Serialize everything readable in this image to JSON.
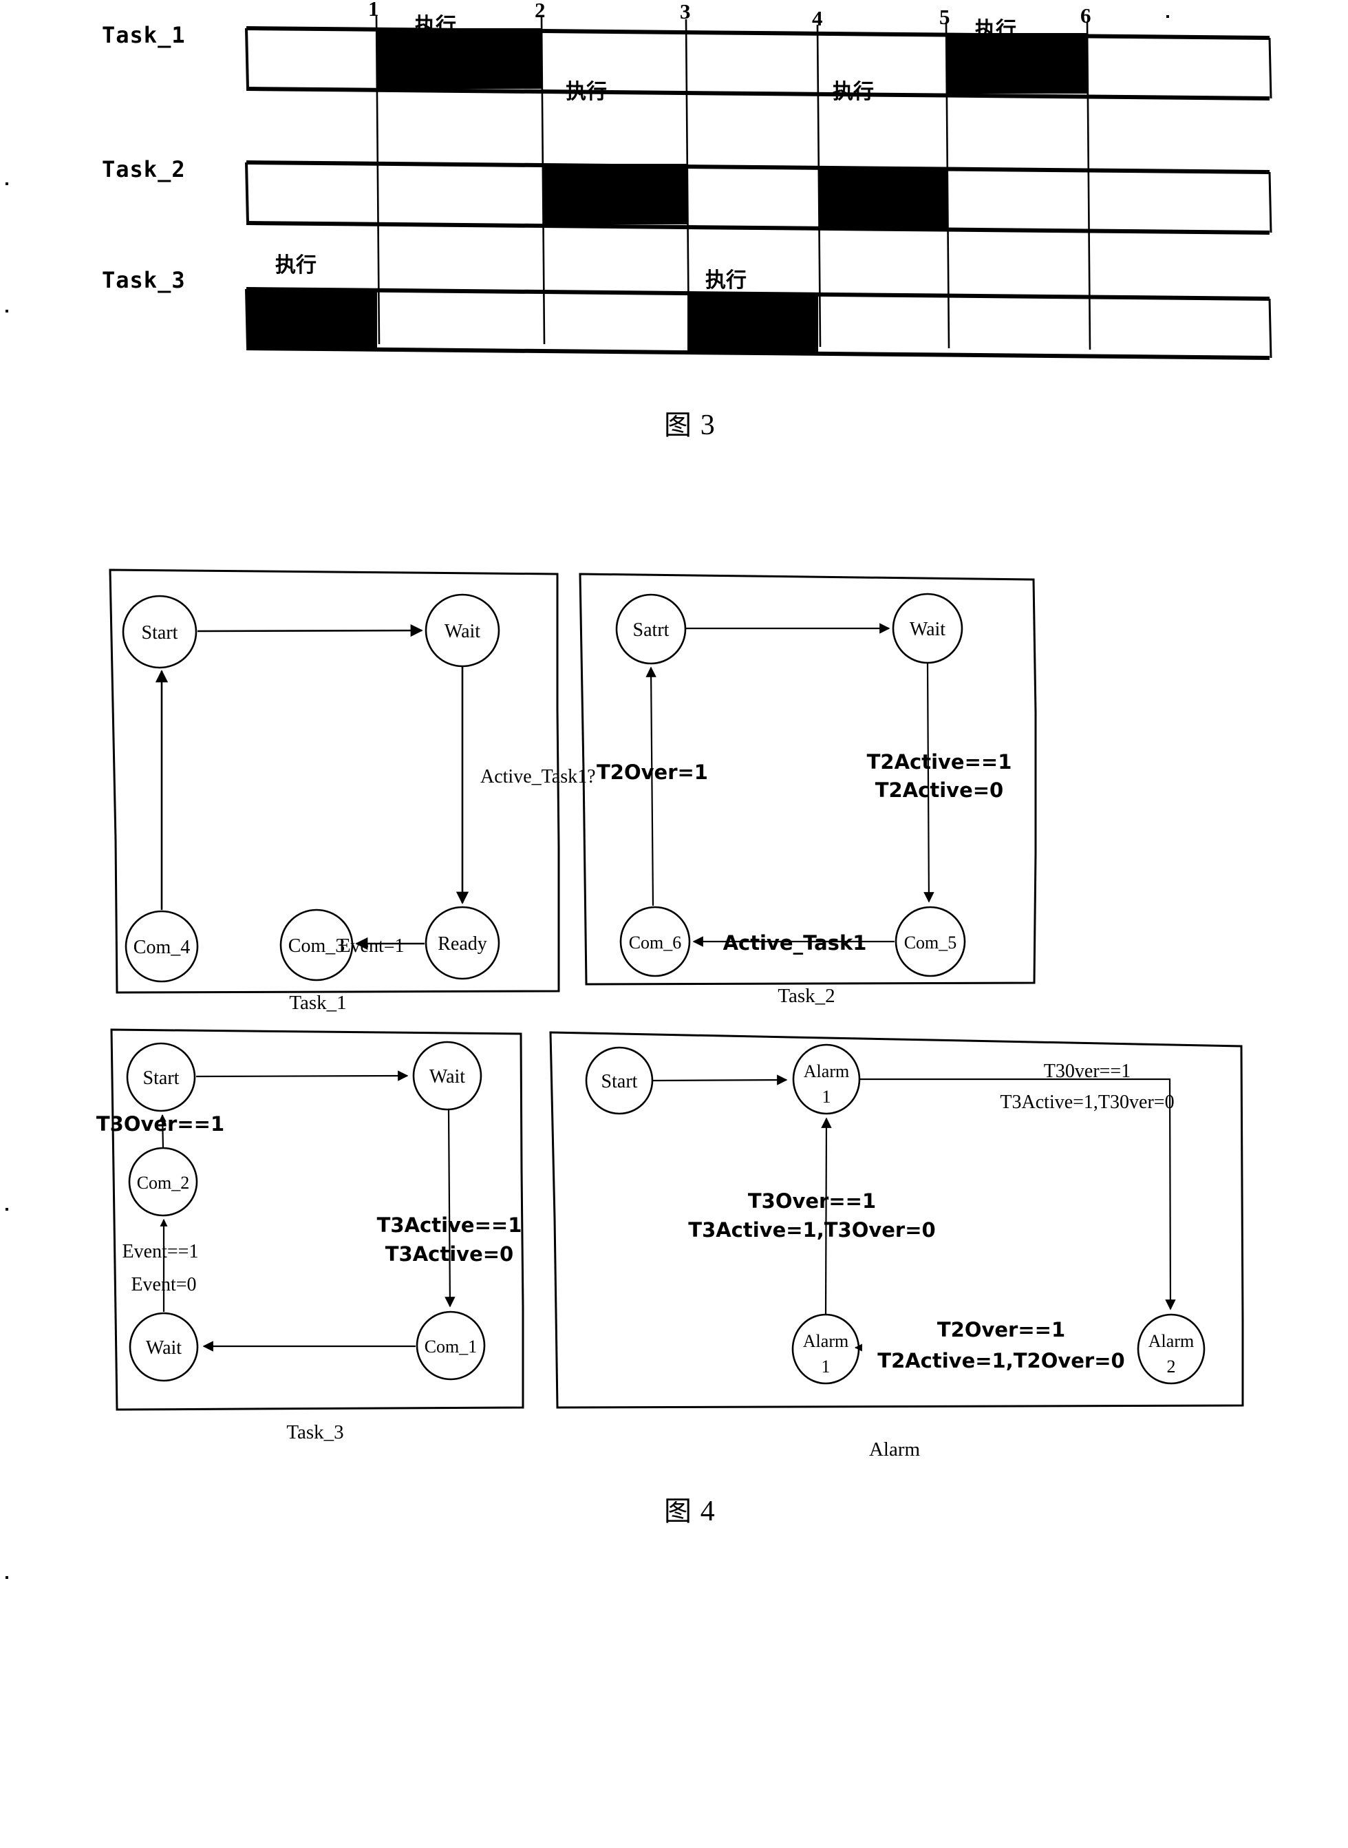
{
  "figure3": {
    "caption_cn": "图",
    "caption_num": "3",
    "tick_labels": [
      "1",
      "2",
      "3",
      "4",
      "5",
      "6"
    ],
    "exec_label": "执行",
    "rows": [
      {
        "label": "Task_1",
        "cells": [
          false,
          true,
          false,
          false,
          false,
          true,
          false
        ],
        "exec_markers": [
          1,
          5
        ]
      },
      {
        "label": "Task_2",
        "cells": [
          false,
          false,
          true,
          false,
          true,
          false,
          false
        ],
        "exec_markers": [
          2,
          4
        ]
      },
      {
        "label": "Task_3",
        "cells": [
          true,
          false,
          false,
          true,
          false,
          false,
          false
        ],
        "exec_markers": [
          0,
          3
        ]
      }
    ]
  },
  "figure4": {
    "caption_cn": "图",
    "caption_num": "4",
    "boxes": [
      {
        "id": "task1",
        "caption": "Task_1",
        "nodes": [
          {
            "id": "start",
            "label": "Start"
          },
          {
            "id": "wait",
            "label": "Wait"
          },
          {
            "id": "ready",
            "label": "Ready"
          },
          {
            "id": "com3",
            "label": "Com_3"
          },
          {
            "id": "com4",
            "label": "Com_4"
          }
        ],
        "edges": [
          {
            "from": "start",
            "to": "wait",
            "label": ""
          },
          {
            "from": "wait",
            "to": "ready",
            "label": "Active_Task1?"
          },
          {
            "from": "ready",
            "to": "com3",
            "label": ""
          },
          {
            "from": "com3",
            "to": "com4",
            "label": "Event=1"
          },
          {
            "from": "com4",
            "to": "start",
            "label": ""
          }
        ]
      },
      {
        "id": "task2",
        "caption": "Task_2",
        "nodes": [
          {
            "id": "satrt",
            "label": "Satrt"
          },
          {
            "id": "wait",
            "label": "Wait"
          },
          {
            "id": "com5",
            "label": "Com_5"
          },
          {
            "id": "com6",
            "label": "Com_6"
          }
        ],
        "edges": [
          {
            "from": "satrt",
            "to": "wait",
            "label": ""
          },
          {
            "from": "wait",
            "to": "com5",
            "label_line1": "T2Active==1",
            "label_line2": "T2Active=0"
          },
          {
            "from": "com5",
            "to": "com6",
            "label": "Active_Task1"
          },
          {
            "from": "com6",
            "to": "satrt",
            "label": "T2Over=1"
          }
        ]
      },
      {
        "id": "task3",
        "caption": "Task_3",
        "nodes": [
          {
            "id": "start",
            "label": "Start"
          },
          {
            "id": "wait_top",
            "label": "Wait"
          },
          {
            "id": "com2",
            "label": "Com_2"
          },
          {
            "id": "com1",
            "label": "Com_1"
          },
          {
            "id": "wait_bottom",
            "label": "Wait"
          }
        ],
        "edges": [
          {
            "from": "start",
            "to": "wait_top",
            "label": ""
          },
          {
            "from": "wait_top",
            "to": "com1",
            "label_line1": "T3Active==1",
            "label_line2": "T3Active=0"
          },
          {
            "from": "com1",
            "to": "wait_bottom",
            "label": ""
          },
          {
            "from": "wait_bottom",
            "to": "com2",
            "label_line1": "Event==1",
            "label_line2": "Event=0"
          },
          {
            "from": "com2",
            "to": "start",
            "label": "T3Over==1"
          }
        ]
      },
      {
        "id": "alarm",
        "caption": "Alarm",
        "nodes": [
          {
            "id": "start",
            "label": "Start"
          },
          {
            "id": "alarm1_top",
            "label_line1": "Alarm",
            "label_line2": "1"
          },
          {
            "id": "alarm2",
            "label_line1": "Alarm",
            "label_line2": "2"
          },
          {
            "id": "alarm1_bottom",
            "label_line1": "Alarm",
            "label_line2": "1"
          }
        ],
        "edges": [
          {
            "from": "start",
            "to": "alarm1_top",
            "label": ""
          },
          {
            "from": "alarm1_top",
            "to": "alarm2",
            "label_line1": "T30ver==1",
            "label_line2": "T3Active=1,T30ver=0"
          },
          {
            "from": "alarm2",
            "to": "alarm1_bottom",
            "label_line1": "T2Over==1",
            "label_line2": "T2Active=1,T2Over=0"
          },
          {
            "from": "alarm1_bottom",
            "to": "alarm1_top",
            "label_line1": "T3Over==1",
            "label_line2": "T3Active=1,T3Over=0"
          }
        ]
      }
    ]
  }
}
